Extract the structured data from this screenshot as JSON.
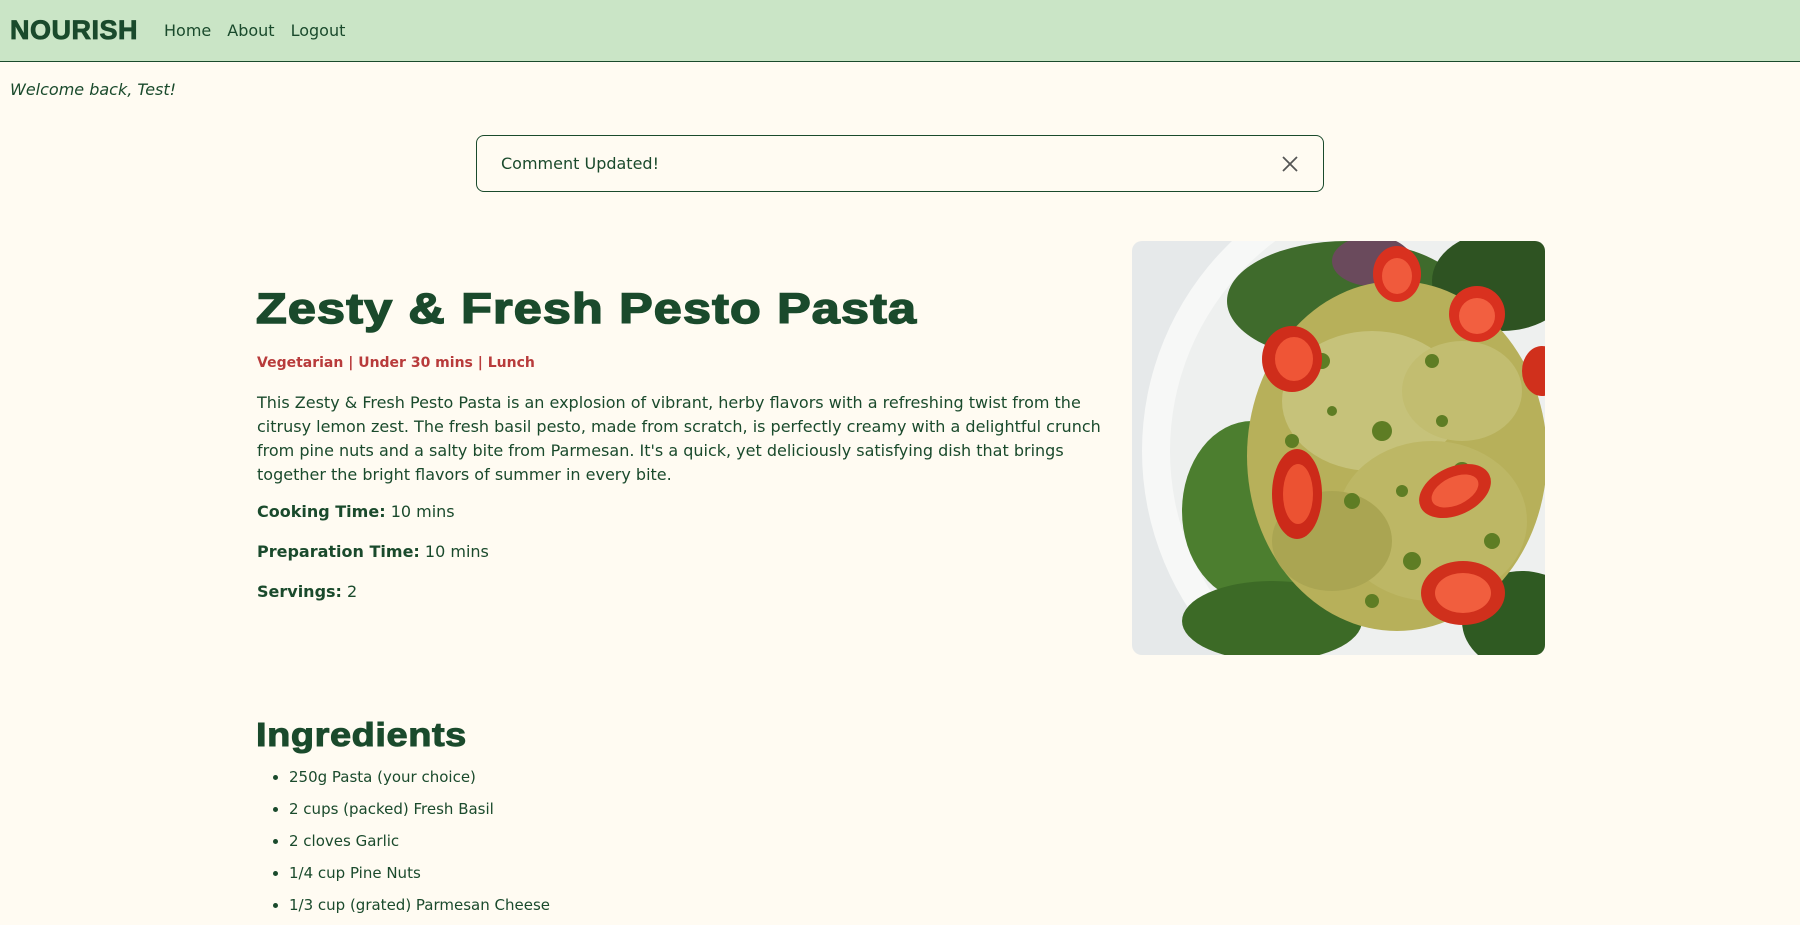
{
  "nav": {
    "brand": "NOURISH",
    "links": [
      "Home",
      "About",
      "Logout"
    ]
  },
  "welcome": "Welcome back, Test!",
  "alert": {
    "message": "Comment Updated!"
  },
  "recipe": {
    "title": "Zesty & Fresh Pesto Pasta",
    "tags": "Vegetarian | Under 30 mins | Lunch",
    "description": "This Zesty & Fresh Pesto Pasta is an explosion of vibrant, herby flavors with a refreshing twist from the citrusy lemon zest. The fresh basil pesto, made from scratch, is perfectly creamy with a delightful crunch from pine nuts and a salty bite from Parmesan. It's a quick, yet deliciously satisfying dish that brings together the bright flavors of summer in every bite.",
    "cooking_time_label": "Cooking Time:",
    "cooking_time": "10 mins",
    "prep_time_label": "Preparation Time:",
    "prep_time": "10 mins",
    "servings_label": "Servings:",
    "servings": "2"
  },
  "ingredients": {
    "title": "Ingredients",
    "items": [
      "250g Pasta (your choice)",
      "2 cups (packed) Fresh Basil",
      "2 cloves Garlic",
      "1/4 cup Pine Nuts",
      "1/3 cup (grated) Parmesan Cheese"
    ]
  },
  "colors": {
    "nav_bg": "#cae5c6",
    "page_bg": "#fffbf2",
    "primary_text": "#1a4a2c",
    "tag_red": "#b83b3b"
  }
}
